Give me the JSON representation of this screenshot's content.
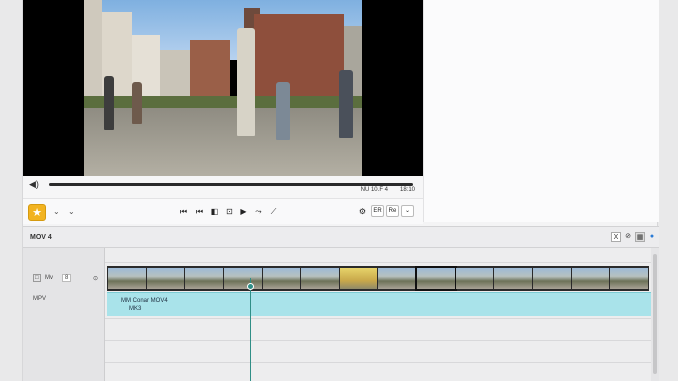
{
  "viewer": {
    "timecode_current": "NU 10.F 4",
    "timecode_total": "18:10"
  },
  "controls": {
    "dd1": "⌄",
    "dd2": "⌄",
    "buttons": [
      "⏮",
      "⏮",
      "◧",
      "⊡",
      "▶",
      "⤳",
      "⟋"
    ],
    "right_buttons": [
      "ER",
      "Re",
      "⌄"
    ]
  },
  "timeline": {
    "title": "MOV 4",
    "tools": [
      "X",
      "⊘",
      "▦",
      "●"
    ]
  },
  "tracks": {
    "video_head_label": "Mv",
    "video_head_tag": "8",
    "audio_head_label": "MPV",
    "clip_line1": "MM Conar MOV4",
    "clip_line2": "MK3"
  },
  "colors": {
    "accent": "#f2b320",
    "audio_clip": "#a9e3ea",
    "playhead": "#2f8e86"
  }
}
